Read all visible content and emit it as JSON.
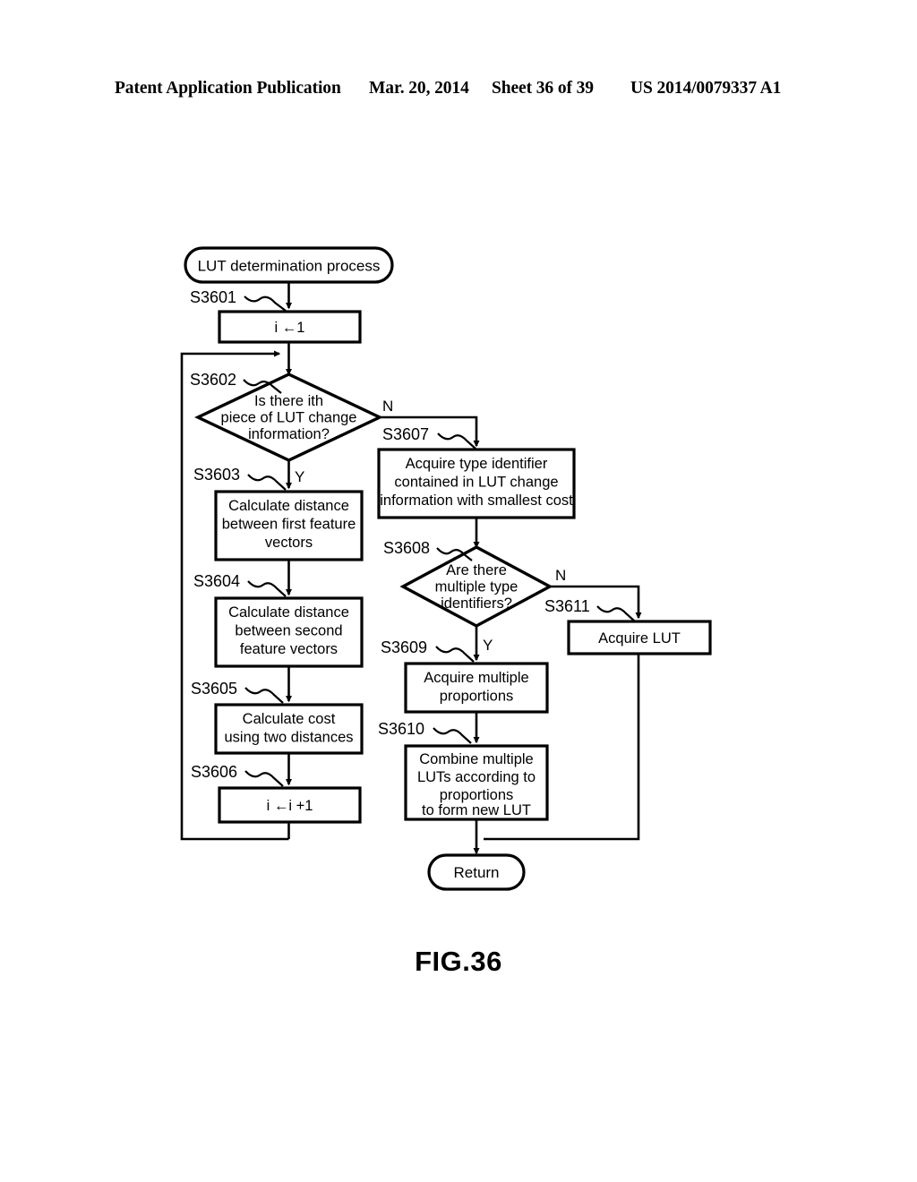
{
  "header": {
    "publication": "Patent Application Publication",
    "date": "Mar. 20, 2014",
    "sheet": "Sheet 36 of 39",
    "patent_number": "US 2014/0079337 A1"
  },
  "figure": {
    "label": "FIG.36"
  },
  "flowchart": {
    "start": {
      "id": "start-terminal",
      "label": "LUT determination process"
    },
    "end": {
      "id": "return-terminal",
      "label": "Return"
    },
    "steps": [
      {
        "ref": "S3601",
        "label": "i ←1"
      },
      {
        "ref": "S3602",
        "label": "Is there ith\npiece of LUT change\ninformation?",
        "lines": [
          "Is there ith",
          "piece of LUT change",
          "information?"
        ],
        "type": "decision",
        "yes": "Y",
        "no": "N"
      },
      {
        "ref": "S3603",
        "label": "Calculate distance between first feature vectors",
        "lines": [
          "Calculate distance",
          "between first feature",
          "vectors"
        ]
      },
      {
        "ref": "S3604",
        "label": "Calculate distance between second feature vectors",
        "lines": [
          "Calculate distance",
          "between second",
          "feature vectors"
        ]
      },
      {
        "ref": "S3605",
        "label": "Calculate cost using two distances",
        "lines": [
          "Calculate cost",
          "using two distances"
        ]
      },
      {
        "ref": "S3606",
        "label": "i ←i +1",
        "lines": [
          "i ←i +1"
        ]
      },
      {
        "ref": "S3607",
        "label": "Acquire type identifier contained in LUT change information with smallest cost",
        "lines": [
          "Acquire type identifier",
          "contained in LUT change",
          "information with smallest cost"
        ]
      },
      {
        "ref": "S3608",
        "label": "Are there multiple type identifiers?",
        "lines": [
          "Are there",
          "multiple type",
          "identifiers?"
        ],
        "type": "decision",
        "yes": "Y",
        "no": "N"
      },
      {
        "ref": "S3609",
        "label": "Acquire multiple proportions",
        "lines": [
          "Acquire multiple",
          "proportions"
        ]
      },
      {
        "ref": "S3610",
        "label": "Combine multiple LUTs according to proportions to form new LUT",
        "lines": [
          "Combine multiple",
          "LUTs according to",
          "proportions",
          "to form new LUT"
        ]
      },
      {
        "ref": "S3611",
        "label": "Acquire LUT",
        "lines": [
          "Acquire LUT"
        ]
      }
    ],
    "labels": {
      "s3601": "S3601",
      "s3602": "S3602",
      "s3603": "S3603",
      "s3604": "S3604",
      "s3605": "S3605",
      "s3606": "S3606",
      "s3607": "S3607",
      "s3608": "S3608",
      "s3609": "S3609",
      "s3610": "S3610",
      "s3611": "S3611"
    },
    "branch_labels": {
      "s3602_no": "N",
      "s3602_yes": "Y",
      "s3608_no": "N",
      "s3608_yes": "Y"
    },
    "text": {
      "start_label": "LUT determination process",
      "s3601_body": "i ←1",
      "s3602_l1": "Is there ith",
      "s3602_l2": "piece of LUT change",
      "s3602_l3": "information?",
      "s3603_l1": "Calculate distance",
      "s3603_l2": "between first feature",
      "s3603_l3": "vectors",
      "s3604_l1": "Calculate distance",
      "s3604_l2": "between second",
      "s3604_l3": "feature vectors",
      "s3605_l1": "Calculate cost",
      "s3605_l2": "using two distances",
      "s3606_body": "i ←i +1",
      "s3607_l1": "Acquire type identifier",
      "s3607_l2": "contained in LUT change",
      "s3607_l3": "information with smallest cost",
      "s3608_l1": "Are there",
      "s3608_l2": "multiple type",
      "s3608_l3": "identifiers?",
      "s3609_l1": "Acquire multiple",
      "s3609_l2": "proportions",
      "s3610_l1": "Combine multiple",
      "s3610_l2": "LUTs according to",
      "s3610_l3": "proportions",
      "s3610_l4": "to form new LUT",
      "s3611_body": "Acquire LUT",
      "return_label": "Return"
    }
  },
  "colors": {
    "ink": "#000000",
    "paper": "#ffffff"
  }
}
